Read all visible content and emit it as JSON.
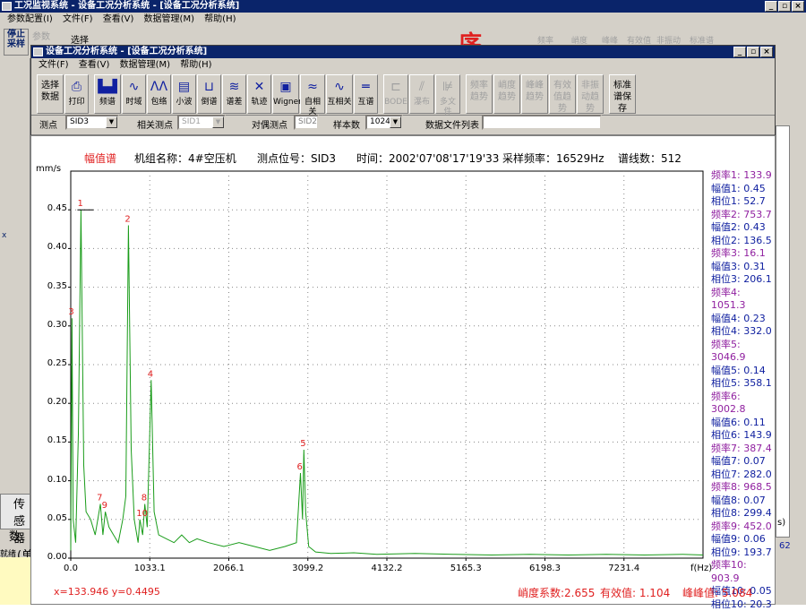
{
  "outer": {
    "title": "工况监视系统 - 设备工况分析系统 - [设备工况分析系统]",
    "menu": [
      "参数配置(I)",
      "文件(F)",
      "查看(V)",
      "数据管理(M)",
      "帮助(H)"
    ],
    "toolbar": [
      "停止采样",
      "参数",
      "选择"
    ],
    "ghost_buttons": [
      "频率",
      "峭度",
      "峰峰",
      "有效值",
      "非振动",
      "标准谱"
    ],
    "overlay_char": "序",
    "left_labels": [
      "传感器",
      "(单",
      "数",
      "就绪"
    ],
    "right_fragments": [
      "s)",
      "62"
    ]
  },
  "inner": {
    "title": "设备工况分析系统 - [设备工况分析系统]",
    "menu": [
      "文件(F)",
      "查看(V)",
      "数据管理(M)",
      "帮助(H)"
    ],
    "toolbar": [
      {
        "label": "选择数据",
        "icon": "",
        "enabled": true
      },
      {
        "label": "打印",
        "icon": "⎙",
        "enabled": true
      },
      {
        "label": "频谱",
        "icon": "▙▟",
        "enabled": true
      },
      {
        "label": "时域",
        "icon": "∿",
        "enabled": true
      },
      {
        "label": "包络",
        "icon": "ΛΛ",
        "enabled": true
      },
      {
        "label": "小波",
        "icon": "▤",
        "enabled": true
      },
      {
        "label": "倒谱",
        "icon": "⊔",
        "enabled": true
      },
      {
        "label": "谱差",
        "icon": "≋",
        "enabled": true
      },
      {
        "label": "轨迹",
        "icon": "✕",
        "enabled": true
      },
      {
        "label": "Wigner",
        "icon": "▣",
        "enabled": true
      },
      {
        "label": "自相关",
        "icon": "≈",
        "enabled": true
      },
      {
        "label": "互相关",
        "icon": "∿",
        "enabled": true
      },
      {
        "label": "互谱",
        "icon": "═",
        "enabled": true
      },
      {
        "label": "BODE",
        "icon": "⊏",
        "enabled": false
      },
      {
        "label": "瀑布",
        "icon": "⫽",
        "enabled": false
      },
      {
        "label": "多文件",
        "icon": "⊯",
        "enabled": false
      },
      {
        "label": "频率趋势",
        "icon": "",
        "enabled": false
      },
      {
        "label": "峭度趋势",
        "icon": "",
        "enabled": false
      },
      {
        "label": "峰峰趋势",
        "icon": "",
        "enabled": false
      },
      {
        "label": "有效值趋势",
        "icon": "",
        "enabled": false
      },
      {
        "label": "非振动趋势",
        "icon": "",
        "enabled": false
      },
      {
        "label": "标准谱保存",
        "icon": "",
        "enabled": true
      }
    ],
    "params": {
      "point_label": "测点",
      "point_value": "SID3",
      "related_label": "相关测点",
      "related_value": "SID1",
      "pair_label": "对偶测点",
      "pair_value": "SID2",
      "samples_label": "样本数",
      "samples_value": "1024",
      "files_label": "数据文件列表",
      "files_value": ""
    }
  },
  "chart_header": {
    "type_label": "幅值谱",
    "unit_name": "机组名称：4#空压机",
    "position": "测点位号：SID3",
    "time": "时间：2002'07'08'17'19'33",
    "sample_rate": "采样频率：16529Hz",
    "lines": "谱线数：512"
  },
  "peaks": [
    [
      "频率1: 133.9",
      "幅值1: 0.45",
      "相位1: 52.7"
    ],
    [
      "频率2: 753.7",
      "幅值2: 0.43",
      "相位2: 136.5"
    ],
    [
      "频率3: 16.1",
      "幅值3: 0.31",
      "相位3: 206.1"
    ],
    [
      "频率4: 1051.3",
      "幅值4: 0.23",
      "相位4: 332.0"
    ],
    [
      "频率5: 3046.9",
      "幅值5: 0.14",
      "相位5: 358.1"
    ],
    [
      "频率6: 3002.8",
      "幅值6: 0.11",
      "相位6: 143.9"
    ],
    [
      "频率7: 387.4",
      "幅值7: 0.07",
      "相位7: 282.0"
    ],
    [
      "频率8: 968.5",
      "幅值8: 0.07",
      "相位8: 299.4"
    ],
    [
      "频率9: 452.0",
      "幅值9: 0.06",
      "相位9: 193.7"
    ],
    [
      "频率10: 903.9",
      "幅值10: 0.05",
      "相位10: 20.3"
    ]
  ],
  "footer": {
    "cursor": "x=133.946   y=0.4495",
    "kurtosis": "峭度系数:2.655",
    "rms": "有效值:  1.104",
    "peak_peak": "峰峰值:  5.084"
  },
  "colors": {
    "series": "#1a9c1a",
    "peak_label": "#e02020",
    "freq": "#9020a0",
    "amp_phase": "#1020a0",
    "accent": "#e02020"
  },
  "chart_data": {
    "type": "line",
    "title": "幅值谱",
    "ylabel": "mm/s",
    "xlabel": "f(Hz)",
    "xlim": [
      0,
      8264.5
    ],
    "ylim": [
      0,
      0.5
    ],
    "xticks": [
      "0.0",
      "1033.1",
      "2066.1",
      "3099.2",
      "4132.2",
      "5165.3",
      "6198.3",
      "7231.4"
    ],
    "yticks": [
      "0.00",
      "0.05",
      "0.10",
      "0.15",
      "0.20",
      "0.25",
      "0.30",
      "0.35",
      "0.40",
      "0.45"
    ],
    "series": [
      {
        "x": [
          0,
          16.1,
          32,
          64,
          100,
          133.9,
          170,
          200,
          260,
          320,
          387.4,
          420,
          452,
          500,
          560,
          620,
          680,
          720,
          753.7,
          790,
          830,
          880,
          903.9,
          940,
          968.5,
          1000,
          1051.3,
          1090,
          1150,
          1250,
          1350,
          1450,
          1550,
          1650,
          1800,
          2000,
          2200,
          2400,
          2600,
          2800,
          2950,
          3002.8,
          3030,
          3046.9,
          3070,
          3110,
          3200,
          3400,
          3700,
          4000,
          4500,
          5000,
          5500,
          6000,
          6500,
          7000,
          7500,
          8000,
          8264
        ],
        "y": [
          0.01,
          0.31,
          0.05,
          0.02,
          0.16,
          0.45,
          0.12,
          0.06,
          0.05,
          0.03,
          0.07,
          0.03,
          0.06,
          0.04,
          0.03,
          0.02,
          0.05,
          0.08,
          0.43,
          0.14,
          0.05,
          0.02,
          0.05,
          0.03,
          0.07,
          0.04,
          0.23,
          0.06,
          0.03,
          0.025,
          0.02,
          0.03,
          0.02,
          0.025,
          0.02,
          0.015,
          0.02,
          0.015,
          0.01,
          0.015,
          0.02,
          0.11,
          0.05,
          0.14,
          0.06,
          0.015,
          0.008,
          0.006,
          0.007,
          0.005,
          0.006,
          0.005,
          0.004,
          0.005,
          0.004,
          0.005,
          0.004,
          0.005,
          0.004
        ]
      }
    ],
    "peak_markers": [
      {
        "label": "1",
        "x": 133.9,
        "y": 0.45
      },
      {
        "label": "2",
        "x": 753.7,
        "y": 0.43
      },
      {
        "label": "3",
        "x": 16.1,
        "y": 0.31
      },
      {
        "label": "4",
        "x": 1051.3,
        "y": 0.23
      },
      {
        "label": "5",
        "x": 3046.9,
        "y": 0.14
      },
      {
        "label": "6",
        "x": 3002.8,
        "y": 0.11
      },
      {
        "label": "7",
        "x": 387.4,
        "y": 0.07
      },
      {
        "label": "8",
        "x": 968.5,
        "y": 0.07
      },
      {
        "label": "9",
        "x": 452.0,
        "y": 0.06
      },
      {
        "label": "10",
        "x": 903.9,
        "y": 0.05
      }
    ],
    "grid": true
  }
}
